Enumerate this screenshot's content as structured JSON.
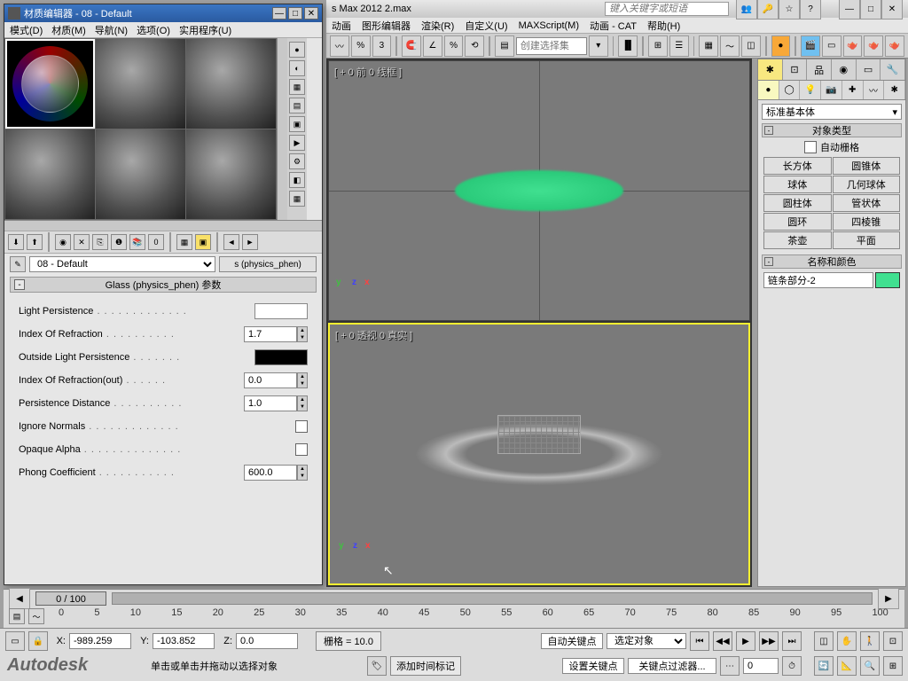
{
  "app": {
    "title_fragment": "s Max 2012   2.max",
    "search_placeholder": "键入关键字或短语",
    "menu": [
      "动画",
      "图形编辑器",
      "渲染(R)",
      "自定义(U)",
      "MAXScript(M)",
      "动画 - CAT",
      "帮助(H)"
    ],
    "selection_set_placeholder": "创建选择集"
  },
  "material_editor": {
    "title": "材质编辑器 - 08 - Default",
    "menu": [
      "模式(D)",
      "材质(M)",
      "导航(N)",
      "选项(O)",
      "实用程序(U)"
    ],
    "current_name": "08 - Default",
    "type_button": "s (physics_phen)",
    "rollout_title": "Glass (physics_phen) 参数",
    "params": {
      "light_persistence": {
        "label": "Light Persistence",
        "type": "color",
        "value": "#ffffff"
      },
      "ior": {
        "label": "Index Of Refraction",
        "type": "spinner",
        "value": "1.7"
      },
      "outside_light": {
        "label": "Outside Light Persistence",
        "type": "color",
        "value": "#000000"
      },
      "ior_out": {
        "label": "Index Of Refraction(out)",
        "type": "spinner",
        "value": "0.0"
      },
      "persist_dist": {
        "label": "Persistence Distance",
        "type": "spinner",
        "value": "1.0"
      },
      "ignore_normals": {
        "label": "Ignore Normals",
        "type": "checkbox",
        "value": false
      },
      "opaque_alpha": {
        "label": "Opaque Alpha",
        "type": "checkbox",
        "value": false
      },
      "phong_coef": {
        "label": "Phong Coefficient",
        "type": "spinner",
        "value": "600.0"
      }
    }
  },
  "viewports": {
    "top": "[ + 0 前 0 线框 ]",
    "bottom": "[ + 0 透视 0 真实 ]"
  },
  "command_panel": {
    "category": "标准基本体",
    "section_obj_type": "对象类型",
    "autogrid": "自动栅格",
    "objects": [
      [
        "长方体",
        "圆锥体"
      ],
      [
        "球体",
        "几何球体"
      ],
      [
        "圆柱体",
        "管状体"
      ],
      [
        "圆环",
        "四棱锥"
      ],
      [
        "茶壶",
        "平面"
      ]
    ],
    "section_name_color": "名称和颜色",
    "object_name": "链条部分-2"
  },
  "timeline": {
    "slider": "0 / 100",
    "ticks": [
      "0",
      "5",
      "10",
      "15",
      "20",
      "25",
      "30",
      "35",
      "40",
      "45",
      "50",
      "55",
      "60",
      "65",
      "70",
      "75",
      "80",
      "85",
      "90",
      "95",
      "100"
    ]
  },
  "status": {
    "x": "-989.259",
    "x_label": "X:",
    "y": "-103.852",
    "y_label": "Y:",
    "z": "0.0",
    "z_label": "Z:",
    "grid": "栅格 = 10.0",
    "autokey": "自动关键点",
    "selected": "选定对象",
    "setkey": "设置关键点",
    "keyfilter": "关键点过滤器...",
    "add_time_tag": "添加时间标记",
    "hint": "单击或单击并拖动以选择对象"
  },
  "brand": "Autodesk"
}
